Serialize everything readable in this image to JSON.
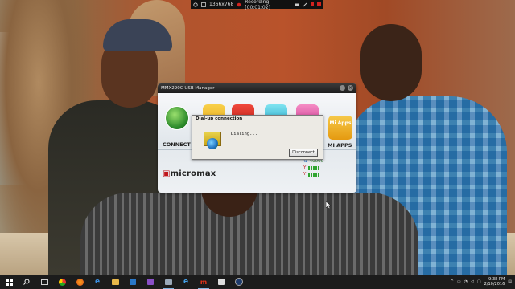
{
  "recording": {
    "resolution": "1366x768",
    "status": "Recording [00:01:02]"
  },
  "usb_manager": {
    "title": "MMX290C USB Manager",
    "connect_label": "CONNECT",
    "miapps_label": "MI APPS",
    "miapps_tile": "Mi Apps",
    "brand": "micromax",
    "stats_value": "40000"
  },
  "dialog": {
    "title": "Dial-up connection",
    "status": "Dialing...",
    "disconnect_label": "Disconnect"
  },
  "taskbar": {
    "time": "9:38 PM",
    "date": "2/10/2016"
  },
  "colors": {
    "brand_red": "#c0151b",
    "taskbar": "#1c1c1c",
    "record_red": "#d2231f"
  }
}
